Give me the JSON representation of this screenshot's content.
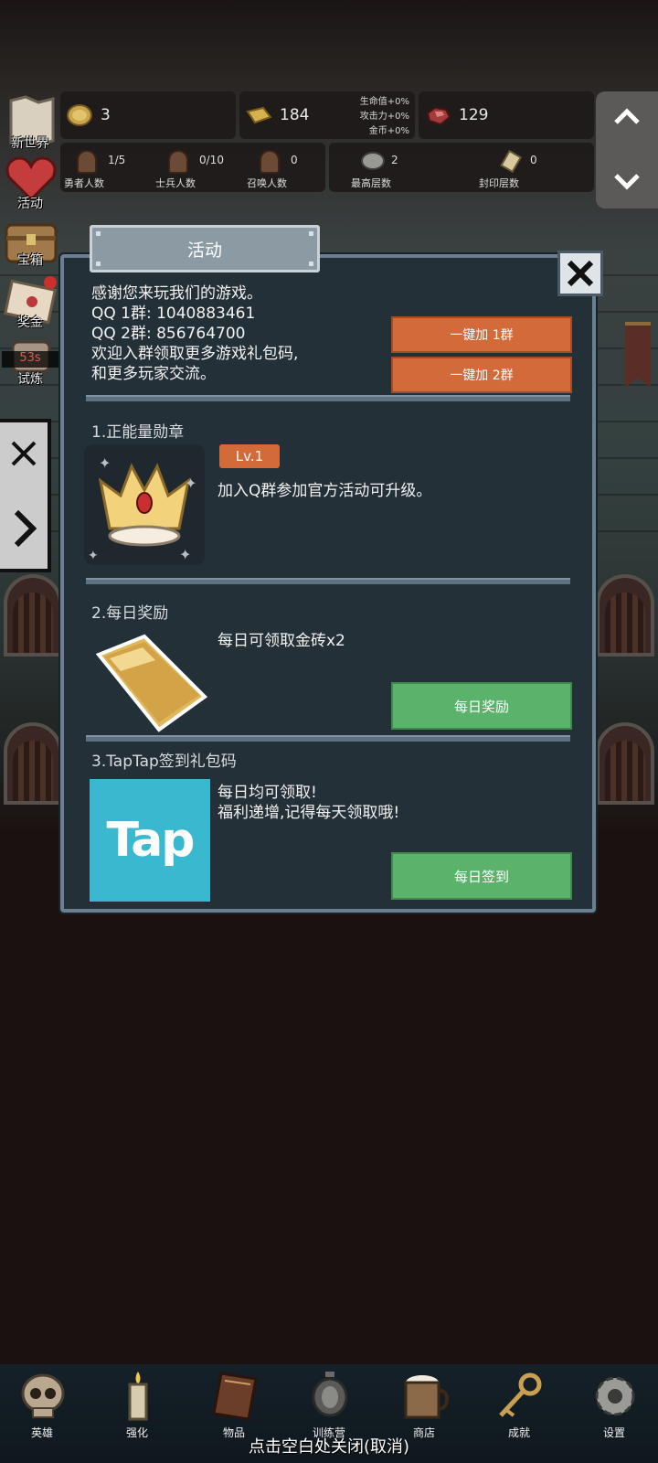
{
  "hud": {
    "coins": "3",
    "gold_bricks": "184",
    "gems": "129",
    "bonuses": [
      "生命值+0%",
      "攻击力+0%",
      "金币+0%"
    ],
    "counts": [
      {
        "value": "1/5",
        "label": "勇者人数"
      },
      {
        "value": "0/10",
        "label": "士兵人数"
      },
      {
        "value": "0",
        "label": "召唤人数"
      },
      {
        "value": "2",
        "label": "最高层数"
      },
      {
        "value": "0",
        "label": "封印层数"
      }
    ]
  },
  "side_menu": {
    "items": [
      {
        "label": "新世界",
        "icon": "map-icon"
      },
      {
        "label": "活动",
        "icon": "heart-icon"
      },
      {
        "label": "宝箱",
        "icon": "chest-icon"
      },
      {
        "label": "奖金",
        "icon": "envelope-icon"
      },
      {
        "label": "试炼",
        "icon": "trial-icon"
      }
    ],
    "timer": "53s"
  },
  "dialog": {
    "tab_title": "活动",
    "intro": "感谢您来玩我们的游戏。\nQQ 1群: 1040883461\nQQ 2群: 856764700\n欢迎入群领取更多游戏礼包码,\n和更多玩家交流。",
    "join_group1": "一键加 1群",
    "join_group2": "一键加 2群",
    "sections": [
      {
        "title": "1.正能量勋章",
        "badge": "Lv.1",
        "desc": "加入Q群参加官方活动可升级。"
      },
      {
        "title": "2.每日奖励",
        "desc": "每日可领取金砖x2",
        "button": "每日奖励"
      },
      {
        "title": "3.TapTap签到礼包码",
        "desc": "每日均可领取!\n福利递增,记得每天领取哦!",
        "button": "每日签到",
        "logo_text": "Tap"
      }
    ]
  },
  "bottom_nav": [
    {
      "label": "英雄",
      "icon": "skull-icon"
    },
    {
      "label": "强化",
      "icon": "candle-icon"
    },
    {
      "label": "物品",
      "icon": "book-icon"
    },
    {
      "label": "训练营",
      "icon": "lantern-icon"
    },
    {
      "label": "商店",
      "icon": "mug-icon"
    },
    {
      "label": "成就",
      "icon": "key-icon"
    },
    {
      "label": "设置",
      "icon": "gear-icon"
    }
  ],
  "close_hint": "点击空白处关闭(取消)",
  "colors": {
    "dialog_bg": "#243037",
    "dialog_border": "#6b7f92",
    "orange_button": "#d26a39",
    "green_button": "#5bb26a",
    "tap_blue": "#3ab8cf"
  }
}
